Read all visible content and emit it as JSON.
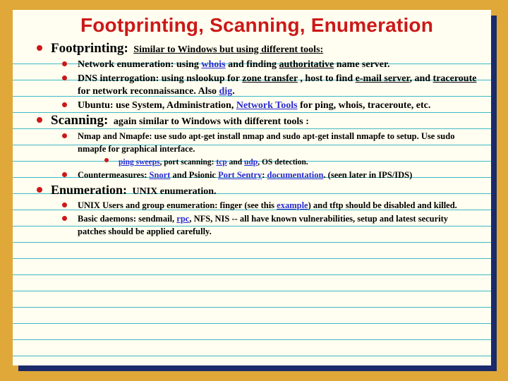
{
  "title": "Footprinting, Scanning, Enumeration",
  "footprinting": {
    "lead": "Footprinting:",
    "aside1": "Similar to Windows but using different tools:",
    "b1_a": "Network enumeration: using ",
    "b1_l1": "whois",
    "b1_b": " and finding ",
    "b1_u1": "authoritative",
    "b1_c": " name server.",
    "b2_a": "DNS interrogation: using nslookup for ",
    "b2_u1": "zone transfer",
    "b2_b": " , host to find ",
    "b2_u2": "e-mail server",
    "b2_c": ", and ",
    "b2_u3": "traceroute",
    "b2_d": " for network reconnaissance.  Also ",
    "b2_l1": "dig",
    "b2_e": ".",
    "b3_a": "Ubuntu: use System, Administration, ",
    "b3_l1": "Network Tools",
    "b3_b": " for ping, whois, traceroute, etc."
  },
  "scanning": {
    "lead": "Scanning:",
    "aside": "again similar to Windows with different tools :",
    "b1": "Nmap and Nmapfe: use sudo apt-get install nmap and sudo apt-get install nmapfe to setup. Use sudo nmapfe for graphical interface.",
    "sub1_l1": "ping sweeps",
    "sub1_a": ", port scanning: ",
    "sub1_l2": "tcp",
    "sub1_b": " and ",
    "sub1_l3": "udp",
    "sub1_c": ", OS detection.",
    "b2_a": "Countermeasures: ",
    "b2_l1": "Snort",
    "b2_b": " and Psionic ",
    "b2_l2": "Port Sentry",
    "b2_c": ": ",
    "b2_l3": "documentation",
    "b2_d": ". (seen later in IPS/IDS)"
  },
  "enumeration": {
    "lead": "Enumeration:",
    "aside": "UNIX enumeration.",
    "b1_a": "UNIX Users and group enumeration: finger (see this ",
    "b1_l1": "example",
    "b1_b": ") and tftp should be disabled and killed.",
    "b2_a": "Basic daemons: sendmail, ",
    "b2_l1": "rpc",
    "b2_b": ", NFS, NIS -- all have known vulnerabilities, setup and latest security patches should be applied carefully."
  }
}
